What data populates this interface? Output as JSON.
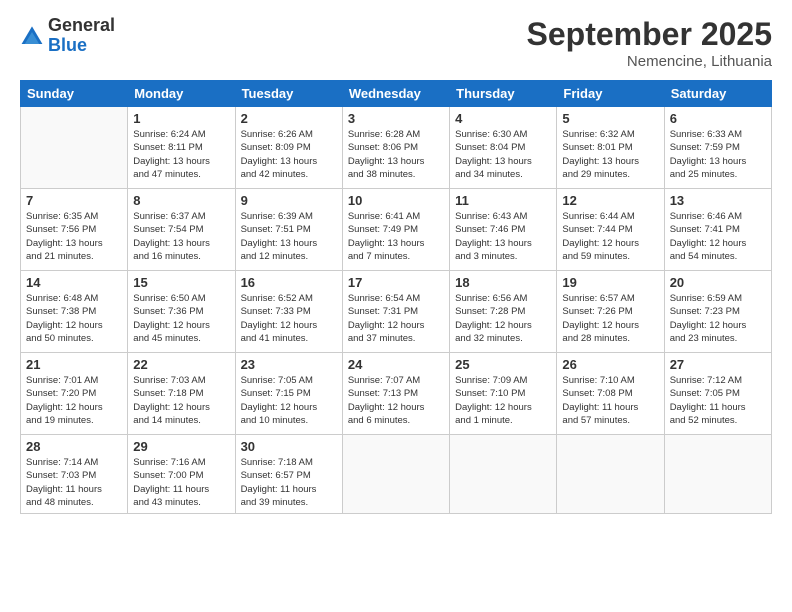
{
  "header": {
    "logo": {
      "general": "General",
      "blue": "Blue"
    },
    "title": "September 2025",
    "subtitle": "Nemencine, Lithuania"
  },
  "days_of_week": [
    "Sunday",
    "Monday",
    "Tuesday",
    "Wednesday",
    "Thursday",
    "Friday",
    "Saturday"
  ],
  "weeks": [
    [
      {
        "day": "",
        "info": ""
      },
      {
        "day": "1",
        "info": "Sunrise: 6:24 AM\nSunset: 8:11 PM\nDaylight: 13 hours\nand 47 minutes."
      },
      {
        "day": "2",
        "info": "Sunrise: 6:26 AM\nSunset: 8:09 PM\nDaylight: 13 hours\nand 42 minutes."
      },
      {
        "day": "3",
        "info": "Sunrise: 6:28 AM\nSunset: 8:06 PM\nDaylight: 13 hours\nand 38 minutes."
      },
      {
        "day": "4",
        "info": "Sunrise: 6:30 AM\nSunset: 8:04 PM\nDaylight: 13 hours\nand 34 minutes."
      },
      {
        "day": "5",
        "info": "Sunrise: 6:32 AM\nSunset: 8:01 PM\nDaylight: 13 hours\nand 29 minutes."
      },
      {
        "day": "6",
        "info": "Sunrise: 6:33 AM\nSunset: 7:59 PM\nDaylight: 13 hours\nand 25 minutes."
      }
    ],
    [
      {
        "day": "7",
        "info": "Sunrise: 6:35 AM\nSunset: 7:56 PM\nDaylight: 13 hours\nand 21 minutes."
      },
      {
        "day": "8",
        "info": "Sunrise: 6:37 AM\nSunset: 7:54 PM\nDaylight: 13 hours\nand 16 minutes."
      },
      {
        "day": "9",
        "info": "Sunrise: 6:39 AM\nSunset: 7:51 PM\nDaylight: 13 hours\nand 12 minutes."
      },
      {
        "day": "10",
        "info": "Sunrise: 6:41 AM\nSunset: 7:49 PM\nDaylight: 13 hours\nand 7 minutes."
      },
      {
        "day": "11",
        "info": "Sunrise: 6:43 AM\nSunset: 7:46 PM\nDaylight: 13 hours\nand 3 minutes."
      },
      {
        "day": "12",
        "info": "Sunrise: 6:44 AM\nSunset: 7:44 PM\nDaylight: 12 hours\nand 59 minutes."
      },
      {
        "day": "13",
        "info": "Sunrise: 6:46 AM\nSunset: 7:41 PM\nDaylight: 12 hours\nand 54 minutes."
      }
    ],
    [
      {
        "day": "14",
        "info": "Sunrise: 6:48 AM\nSunset: 7:38 PM\nDaylight: 12 hours\nand 50 minutes."
      },
      {
        "day": "15",
        "info": "Sunrise: 6:50 AM\nSunset: 7:36 PM\nDaylight: 12 hours\nand 45 minutes."
      },
      {
        "day": "16",
        "info": "Sunrise: 6:52 AM\nSunset: 7:33 PM\nDaylight: 12 hours\nand 41 minutes."
      },
      {
        "day": "17",
        "info": "Sunrise: 6:54 AM\nSunset: 7:31 PM\nDaylight: 12 hours\nand 37 minutes."
      },
      {
        "day": "18",
        "info": "Sunrise: 6:56 AM\nSunset: 7:28 PM\nDaylight: 12 hours\nand 32 minutes."
      },
      {
        "day": "19",
        "info": "Sunrise: 6:57 AM\nSunset: 7:26 PM\nDaylight: 12 hours\nand 28 minutes."
      },
      {
        "day": "20",
        "info": "Sunrise: 6:59 AM\nSunset: 7:23 PM\nDaylight: 12 hours\nand 23 minutes."
      }
    ],
    [
      {
        "day": "21",
        "info": "Sunrise: 7:01 AM\nSunset: 7:20 PM\nDaylight: 12 hours\nand 19 minutes."
      },
      {
        "day": "22",
        "info": "Sunrise: 7:03 AM\nSunset: 7:18 PM\nDaylight: 12 hours\nand 14 minutes."
      },
      {
        "day": "23",
        "info": "Sunrise: 7:05 AM\nSunset: 7:15 PM\nDaylight: 12 hours\nand 10 minutes."
      },
      {
        "day": "24",
        "info": "Sunrise: 7:07 AM\nSunset: 7:13 PM\nDaylight: 12 hours\nand 6 minutes."
      },
      {
        "day": "25",
        "info": "Sunrise: 7:09 AM\nSunset: 7:10 PM\nDaylight: 12 hours\nand 1 minute."
      },
      {
        "day": "26",
        "info": "Sunrise: 7:10 AM\nSunset: 7:08 PM\nDaylight: 11 hours\nand 57 minutes."
      },
      {
        "day": "27",
        "info": "Sunrise: 7:12 AM\nSunset: 7:05 PM\nDaylight: 11 hours\nand 52 minutes."
      }
    ],
    [
      {
        "day": "28",
        "info": "Sunrise: 7:14 AM\nSunset: 7:03 PM\nDaylight: 11 hours\nand 48 minutes."
      },
      {
        "day": "29",
        "info": "Sunrise: 7:16 AM\nSunset: 7:00 PM\nDaylight: 11 hours\nand 43 minutes."
      },
      {
        "day": "30",
        "info": "Sunrise: 7:18 AM\nSunset: 6:57 PM\nDaylight: 11 hours\nand 39 minutes."
      },
      {
        "day": "",
        "info": ""
      },
      {
        "day": "",
        "info": ""
      },
      {
        "day": "",
        "info": ""
      },
      {
        "day": "",
        "info": ""
      }
    ]
  ]
}
